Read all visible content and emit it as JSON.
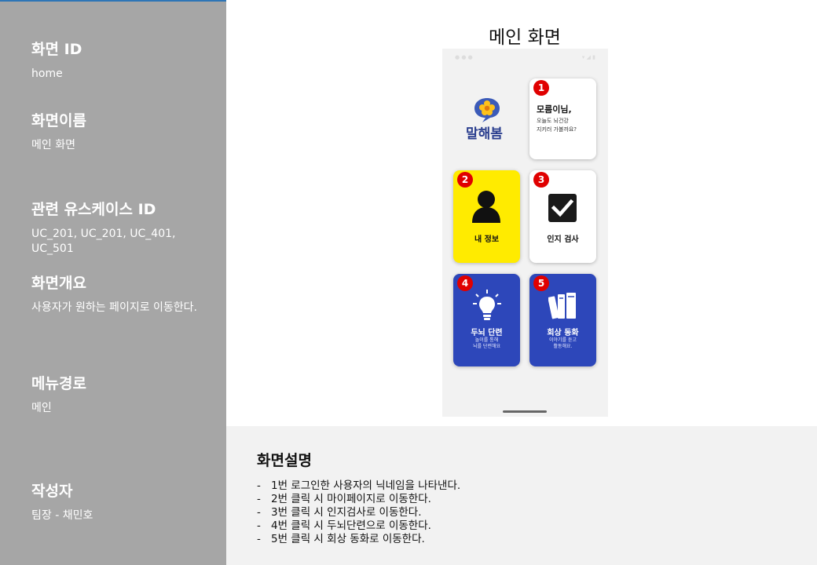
{
  "sidebar": {
    "screen_id_title": "화면 ID",
    "screen_id_value": "home",
    "screen_name_title": "화면이름",
    "screen_name_value": "메인 화면",
    "usecase_title": "관련 유스케이스 ID",
    "usecase_value": "UC_201, UC_201, UC_401, UC_501",
    "overview_title": "화면개요",
    "overview_value": "사용자가 원하는 페이지로 이동한다.",
    "menu_path_title": "메뉴경로",
    "menu_path_value": "메인",
    "author_title": "작성자",
    "author_value": "팀장 - 채민호"
  },
  "main": {
    "screen_label": "메인 화면"
  },
  "phone": {
    "logo_text": "말해봄",
    "greeting": {
      "badge": "1",
      "name": "모름이님,",
      "line1": "오늘도 뇌건강",
      "line2": "지키러 가볼까요?"
    },
    "cards": {
      "my_info": {
        "badge": "2",
        "label": "내 정보",
        "color": "#ffeb00"
      },
      "cognitive_test": {
        "badge": "3",
        "label": "인지 검사",
        "color": "#ffffff"
      },
      "brain_training": {
        "badge": "4",
        "label": "두뇌 단련",
        "desc1": "놀이를 통해",
        "desc2": "뇌를 단련해요",
        "color": "#2d47ba"
      },
      "memory_story": {
        "badge": "5",
        "label": "회상 동화",
        "desc1": "이야기를 듣고",
        "desc2": "활동해요.",
        "color": "#2d47ba"
      }
    }
  },
  "description": {
    "title": "화면설명",
    "items": [
      "1번 로그인한 사용자의 닉네임을 나타낸다.",
      "2번 클릭 시 마이페이지로 이동한다.",
      "3번 클릭 시 인지검사로 이동한다.",
      "4번 클릭 시 두뇌단련으로 이동한다.",
      "5번 클릭 시 회상 동화로 이동한다."
    ]
  },
  "colors": {
    "sidebar_bg": "#a6a6a6",
    "badge_red": "#e00000",
    "logo_blue": "#2b3f8f"
  }
}
